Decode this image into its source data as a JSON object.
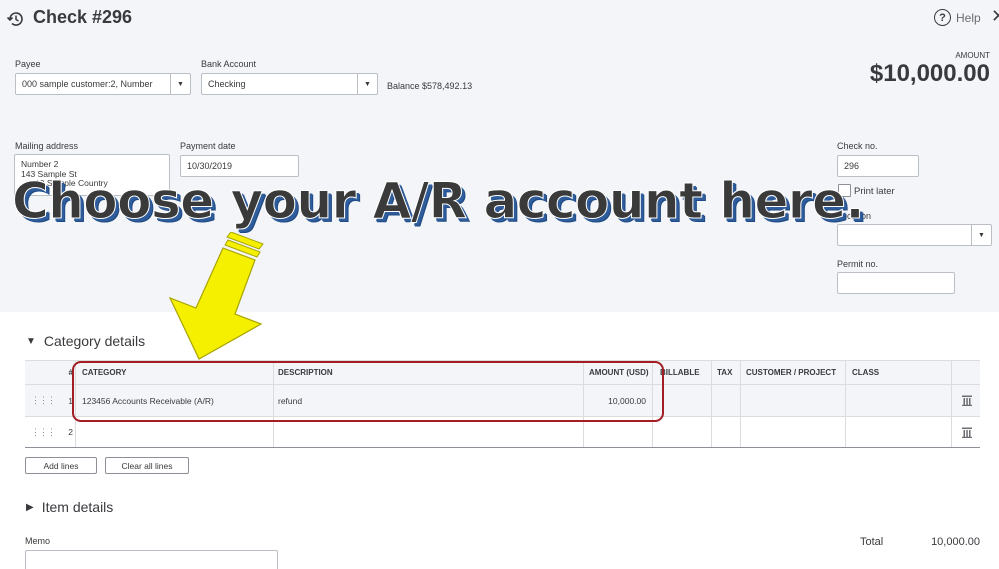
{
  "header": {
    "title": "Check #296",
    "help_label": "Help",
    "close_glyph": "✕"
  },
  "payee": {
    "label": "Payee",
    "value": "000 sample customer:2, Number"
  },
  "bank_account": {
    "label": "Bank Account",
    "value": "Checking",
    "balance": "Balance $578,492.13"
  },
  "amount": {
    "label": "AMOUNT",
    "value": "$10,000.00"
  },
  "mailing_address": {
    "label": "Mailing address",
    "line1": "Number 2",
    "line2": "143 Sample St",
    "line3": "10 Sample Country"
  },
  "payment_date": {
    "label": "Payment date",
    "value": "10/30/2019"
  },
  "check_no": {
    "label": "Check no.",
    "value": "296"
  },
  "print_later": {
    "label": "Print later",
    "checked": false
  },
  "location": {
    "label": "Location",
    "value": ""
  },
  "permit_no": {
    "label": "Permit no.",
    "value": ""
  },
  "annotation": {
    "text": "Choose your A/R account here.",
    "arrow_color": "#f5ef00",
    "box_color": "#a31d24"
  },
  "category_details": {
    "title": "Category details",
    "columns": {
      "num": "#",
      "category": "CATEGORY",
      "description": "DESCRIPTION",
      "amount": "AMOUNT (USD)",
      "billable": "BILLABLE",
      "tax": "TAX",
      "customer": "CUSTOMER / PROJECT",
      "class": "CLASS"
    },
    "rows": [
      {
        "num": "1",
        "category": "123456 Accounts Receivable (A/R)",
        "description": "refund",
        "amount": "10,000.00"
      },
      {
        "num": "2",
        "category": "",
        "description": "",
        "amount": ""
      }
    ],
    "add_lines": "Add lines",
    "clear_all_lines": "Clear all lines"
  },
  "item_details": {
    "title": "Item details"
  },
  "memo": {
    "label": "Memo",
    "value": ""
  },
  "total": {
    "label": "Total",
    "value": "10,000.00"
  }
}
